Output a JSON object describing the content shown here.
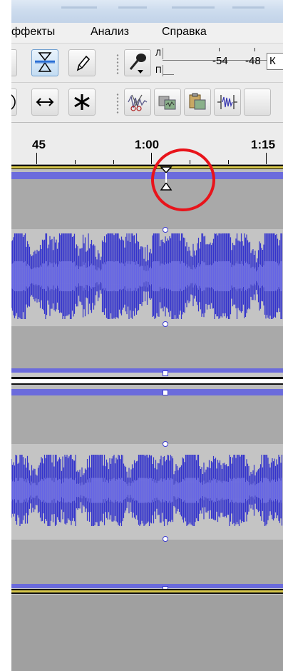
{
  "menu": [
    {
      "label": "ффекты"
    },
    {
      "label": "Анализ"
    },
    {
      "label": "Справка"
    }
  ],
  "toolbar": {
    "tools": [
      {
        "icon": "envelope-tool-icon",
        "active": true
      },
      {
        "icon": "pencil-tool-icon",
        "active": false
      },
      {
        "icon": "time-shift-tool-icon",
        "active": false
      },
      {
        "icon": "multi-tool-icon",
        "active": false
      }
    ],
    "record_meter": {
      "channel_left": "Л",
      "channel_right": "П",
      "scale": [
        "-54",
        "-48"
      ],
      "click_hint": "К"
    },
    "edit_tools": [
      {
        "icon": "silence-audio-icon"
      },
      {
        "icon": "copy-icon"
      },
      {
        "icon": "paste-icon"
      },
      {
        "icon": "trim-audio-icon"
      }
    ]
  },
  "timeline": {
    "labels": [
      "45",
      "1:00",
      "1:15"
    ]
  },
  "tracks": [
    {
      "name": "track-1",
      "envelope": "active"
    },
    {
      "name": "track-2",
      "envelope": "active"
    }
  ],
  "colors": {
    "waveform": "#3333cc",
    "waveform_rms": "#6464e6",
    "highlight_circle": "#e8141b",
    "track_border": "#6b6bdc"
  }
}
